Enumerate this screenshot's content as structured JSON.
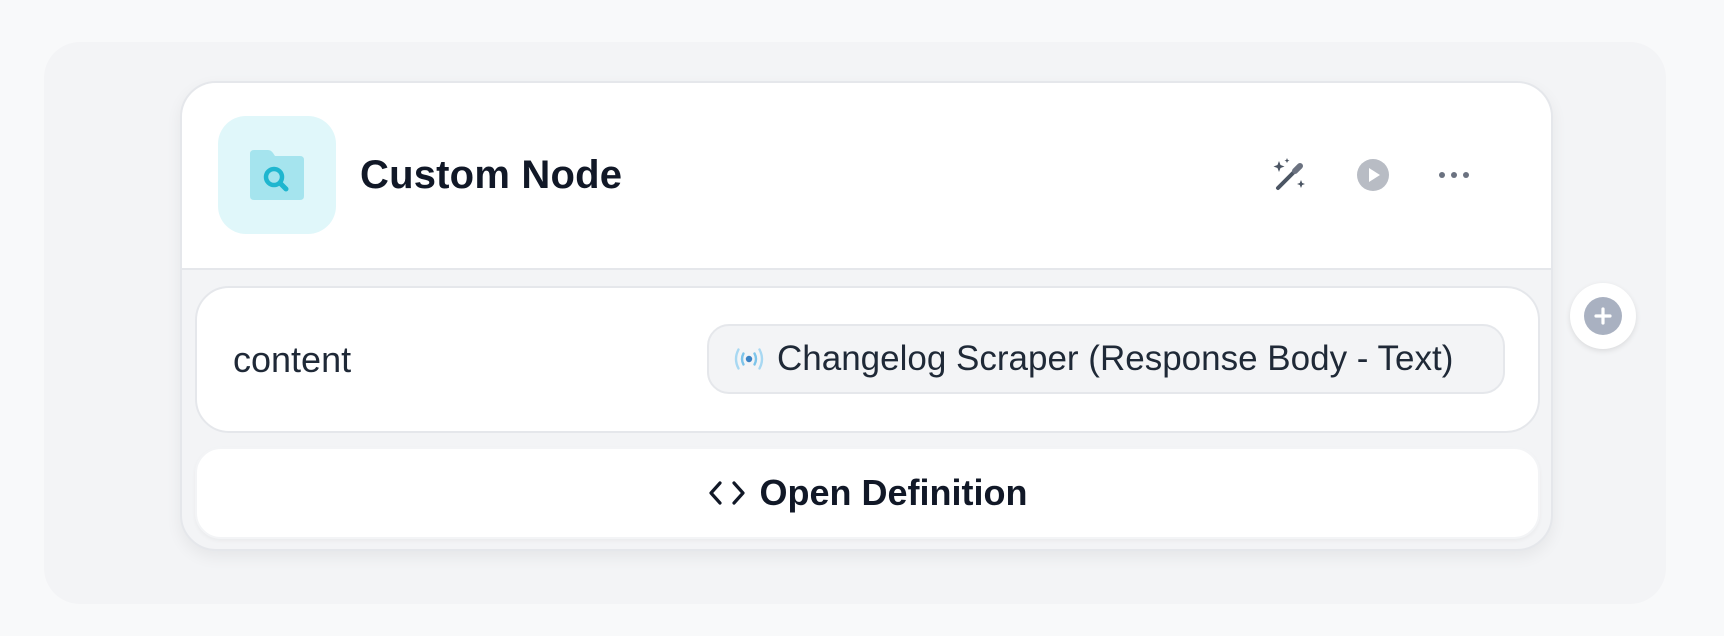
{
  "node": {
    "title": "Custom Node",
    "icon": "folder-search-icon",
    "accent_color": "#22c1d6",
    "icon_tile_color": "#e0f7fa"
  },
  "header_actions": [
    {
      "name": "magic-wand-icon"
    },
    {
      "name": "play-icon"
    },
    {
      "name": "more-icon"
    }
  ],
  "fields": [
    {
      "label": "content",
      "value": "Changelog Scraper (Response Body - Text)",
      "value_icon": "broadcast-icon"
    }
  ],
  "open_definition": {
    "label": "Open Definition",
    "icon": "code-icon"
  },
  "add_connection": {
    "icon": "plus-icon"
  }
}
